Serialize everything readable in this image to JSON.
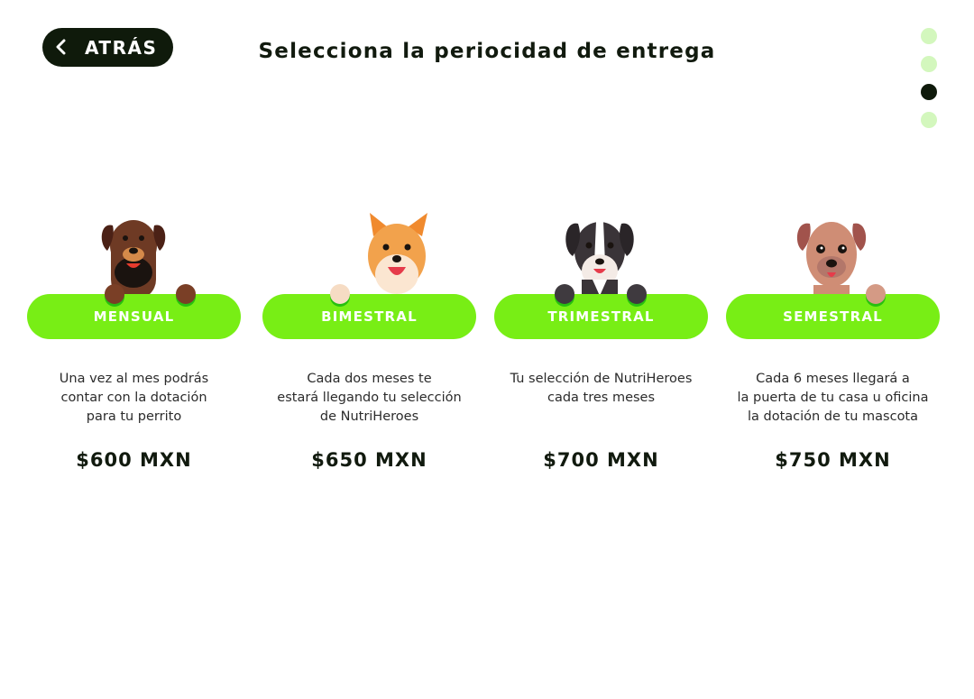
{
  "header": {
    "back_label": "ATRÁS",
    "title": "Selecciona la periocidad de entrega"
  },
  "steps": {
    "total": 4,
    "active_index": 3,
    "inactive_color": "#d3f7bd",
    "active_color": "#0f1a0b"
  },
  "plans": [
    {
      "name": "MENSUAL",
      "description": "Una vez al mes podrás\ncontar con la dotación\npara tu perrito",
      "price": "$600 MXN",
      "dog_icon": "doberman-dog-icon"
    },
    {
      "name": "BIMESTRAL",
      "description": "Cada dos meses te\nestará llegando tu selección\nde NutriHeroes",
      "price": "$650 MXN",
      "dog_icon": "shiba-dog-icon"
    },
    {
      "name": "TRIMESTRAL",
      "description": "Tu selección de NutriHeroes\ncada tres meses",
      "price": "$700 MXN",
      "dog_icon": "border-collie-dog-icon"
    },
    {
      "name": "SEMESTRAL",
      "description": "Cada 6 meses llegará a\nla puerta de tu casa u oficina\nla dotación de tu mascota",
      "price": "$750 MXN",
      "dog_icon": "brown-puppy-dog-icon"
    }
  ],
  "colors": {
    "accent_green": "#78ee15",
    "dark": "#0f1a0b",
    "text": "#111a0e"
  }
}
